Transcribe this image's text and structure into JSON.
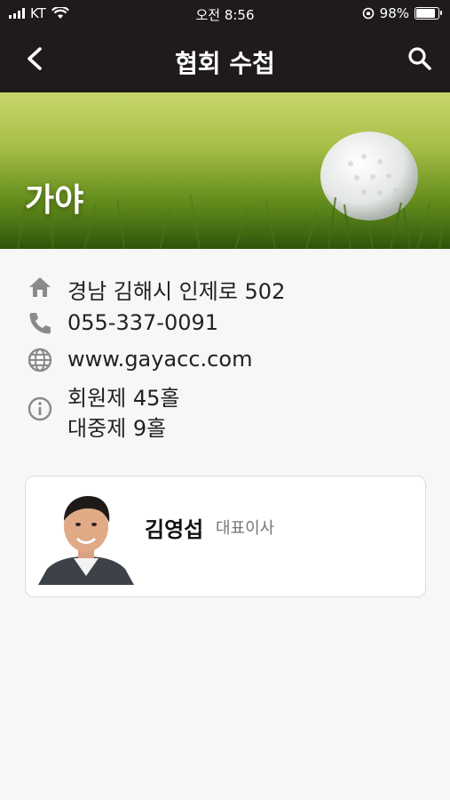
{
  "status_bar": {
    "carrier": "KT",
    "time": "오전 8:56",
    "battery": "98%"
  },
  "nav": {
    "title": "협회 수첩",
    "back_icon": "chevron-left-icon",
    "search_icon": "search-icon"
  },
  "hero": {
    "title": "가야"
  },
  "info": {
    "address": "경남 김해시 인제로 502",
    "phone": "055-337-0091",
    "website": "www.gayacc.com",
    "details": [
      "회원제 45홀",
      "대중제 9홀"
    ]
  },
  "contact": {
    "name": "김영섭",
    "role": "대표이사"
  }
}
